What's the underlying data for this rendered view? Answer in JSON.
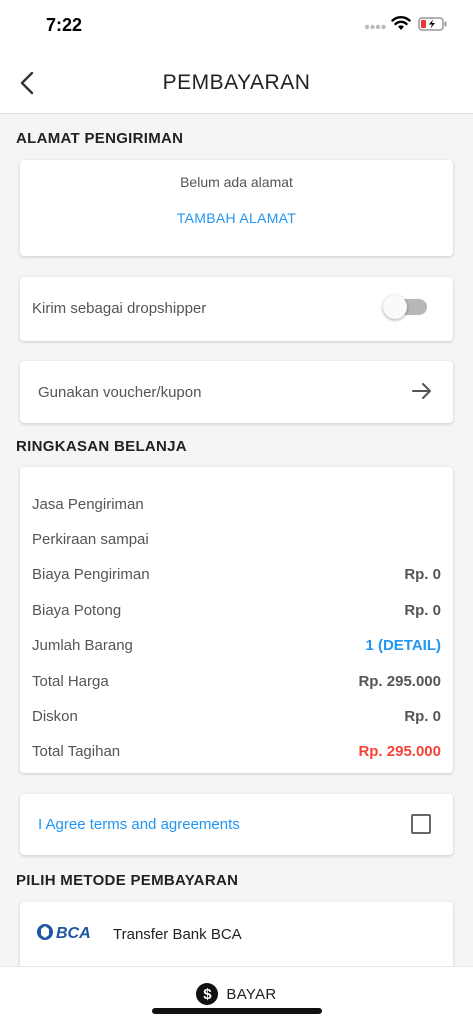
{
  "status_bar": {
    "time": "7:22"
  },
  "header": {
    "title": "PEMBAYARAN"
  },
  "address": {
    "section_title": "ALAMAT PENGIRIMAN",
    "empty_text": "Belum ada alamat",
    "add_label": "TAMBAH ALAMAT"
  },
  "dropshipper": {
    "label": "Kirim sebagai dropshipper",
    "enabled": false
  },
  "voucher": {
    "label": "Gunakan voucher/kupon"
  },
  "summary": {
    "section_title": "RINGKASAN BELANJA",
    "rows": [
      {
        "label": "Jasa Pengiriman",
        "value": ""
      },
      {
        "label": "Perkiraan sampai",
        "value": ""
      },
      {
        "label": "Biaya Pengiriman",
        "value": "Rp. 0"
      },
      {
        "label": "Biaya Potong",
        "value": "Rp. 0"
      },
      {
        "label": "Jumlah Barang",
        "value": "1 (DETAIL)"
      },
      {
        "label": "Total Harga",
        "value": "Rp. 295.000"
      },
      {
        "label": "Diskon",
        "value": "Rp. 0"
      },
      {
        "label": "Total Tagihan",
        "value": "Rp. 295.000"
      }
    ]
  },
  "agreement": {
    "label": "I Agree terms and agreements",
    "checked": false
  },
  "payment_methods": {
    "section_title": "PILIH METODE PEMBAYARAN",
    "items": [
      {
        "logo_text": "BCA",
        "name": "Transfer Bank BCA"
      }
    ]
  },
  "footer": {
    "pay_label": "BAYAR"
  },
  "colors": {
    "accent_blue": "#2196f3",
    "total_red": "#f44336",
    "bca_blue": "#1e56a3"
  }
}
